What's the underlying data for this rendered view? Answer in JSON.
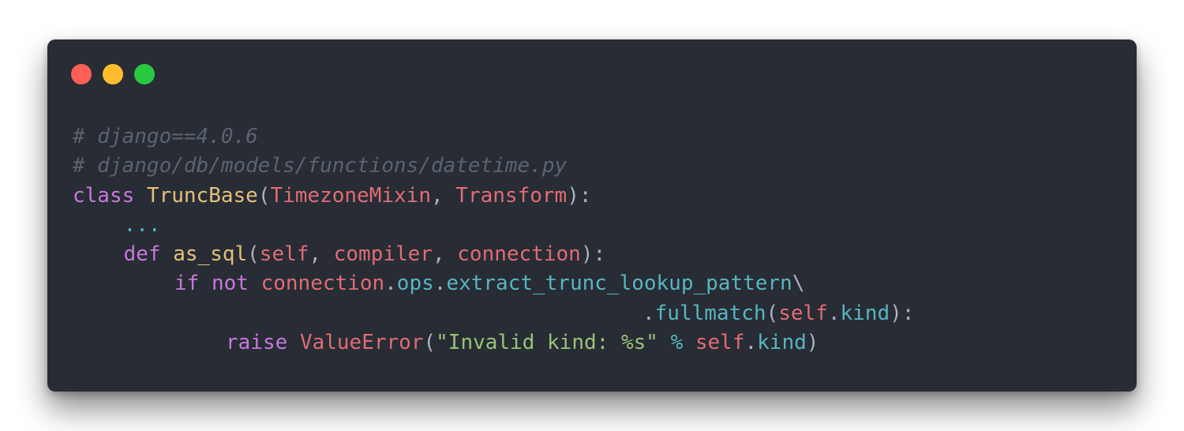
{
  "window": {
    "colors": {
      "background": "#282c34",
      "close": "#ff5f56",
      "minimize": "#ffbd2e",
      "zoom": "#27c93f"
    }
  },
  "code": {
    "line1": {
      "comment": "# django==4.0.6"
    },
    "line2": {
      "comment": "# django/db/models/functions/datetime.py"
    },
    "line3": {
      "kw": "class",
      "name": "TruncBase",
      "open": "(",
      "base1": "TimezoneMixin",
      "comma": ", ",
      "base2": "Transform",
      "close": "):"
    },
    "line4": {
      "ellipsis": "..."
    },
    "line5": {
      "kw": "def",
      "name": "as_sql",
      "open": "(",
      "p1": "self",
      "c1": ", ",
      "p2": "compiler",
      "c2": ", ",
      "p3": "connection",
      "close": "):"
    },
    "line6": {
      "kw1": "if",
      "kw2": "not",
      "obj": "connection",
      "dot1": ".",
      "attr1": "ops",
      "dot2": ".",
      "attr2": "extract_trunc_lookup_pattern",
      "cont": "\\"
    },
    "line7": {
      "dot": ".",
      "method": "fullmatch",
      "open": "(",
      "obj": "self",
      "dot2": ".",
      "attr": "kind",
      "close": "):"
    },
    "line8": {
      "kw": "raise",
      "exc": "ValueError",
      "open": "(",
      "str": "\"Invalid kind: %s\"",
      "op": "%",
      "obj": "self",
      "dot": ".",
      "attr": "kind",
      "close": ")"
    }
  }
}
